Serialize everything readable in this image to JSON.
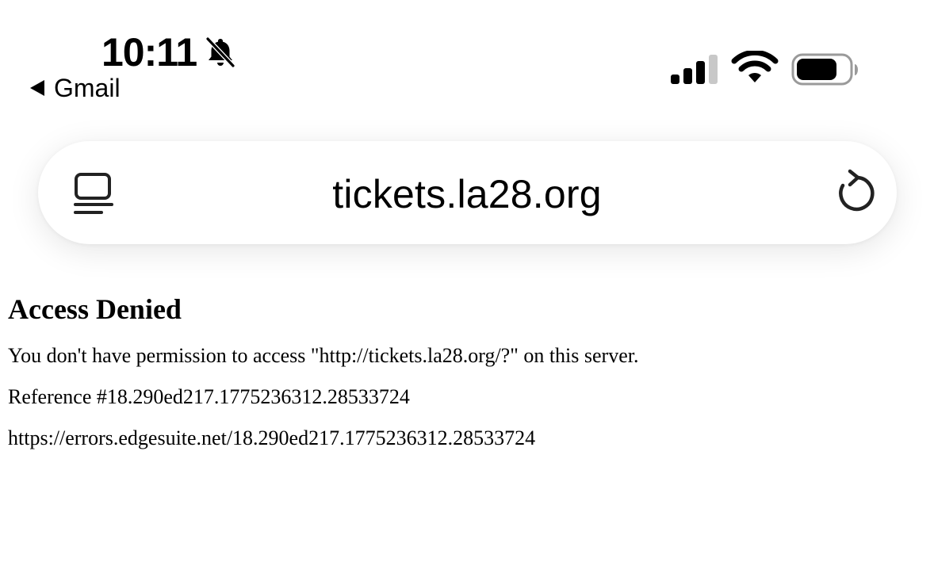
{
  "status_bar": {
    "time": "10:11",
    "back_app": "Gmail",
    "icons": [
      "bell-slash-icon",
      "cellular-signal-icon",
      "wifi-icon",
      "battery-icon"
    ]
  },
  "browser": {
    "url": "tickets.la28.org",
    "left_icon": "tabs-icon",
    "right_icon": "reload-icon"
  },
  "page": {
    "heading": "Access Denied",
    "message": "You don't have permission to access \"http://tickets.la28.org/?\" on this server.",
    "reference": "Reference #18.290ed217.1775236312.28533724",
    "error_url": "https://errors.edgesuite.net/18.290ed217.1775236312.28533724"
  }
}
